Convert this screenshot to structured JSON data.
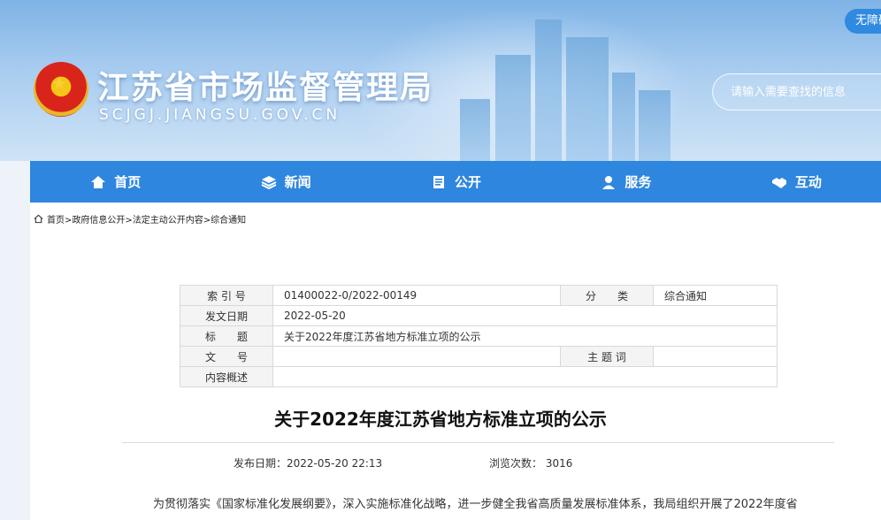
{
  "header": {
    "site_name": "江苏省市场监督管理局",
    "site_domain": "SCJGJ.JIANGSU.GOV.CN",
    "accessibility_label": "无障碍",
    "search_placeholder": "请输入需要查找的信息"
  },
  "nav": {
    "items": [
      {
        "label": "首页",
        "icon": "home-icon"
      },
      {
        "label": "新闻",
        "icon": "layers-icon"
      },
      {
        "label": "公开",
        "icon": "document-icon"
      },
      {
        "label": "服务",
        "icon": "user-icon"
      },
      {
        "label": "互动",
        "icon": "handshake-icon"
      }
    ]
  },
  "breadcrumb": {
    "text": "首页>政府信息公开>法定主动公开内容>综合通知"
  },
  "info_table": {
    "index_label": "索 引 号",
    "index_value": "01400022-0/2022-00149",
    "category_label": "分　　类",
    "category_value": "综合通知",
    "date_label": "发文日期",
    "date_value": "2022-05-20",
    "title_label": "标　　题",
    "title_value": "关于2022年度江苏省地方标准立项的公示",
    "docno_label": "文　　号",
    "docno_value": "",
    "keywords_label": "主 题 词",
    "keywords_value": "",
    "summary_label": "内容概述",
    "summary_value": ""
  },
  "article": {
    "title": "关于2022年度江苏省地方标准立项的公示",
    "publish_label": "发布日期：",
    "publish_value": "2022-05-20 22:13",
    "views_label": "浏览次数：",
    "views_value": "3016",
    "paragraph": "为贯彻落实《国家标准化发展纲要》，深入实施标准化战略，进一步健全我省高质量发展标准体系，我局组织开展了2022年度省"
  },
  "colors": {
    "nav_bg": "#2f86de",
    "a11y_bg": "#2f8ae0"
  }
}
